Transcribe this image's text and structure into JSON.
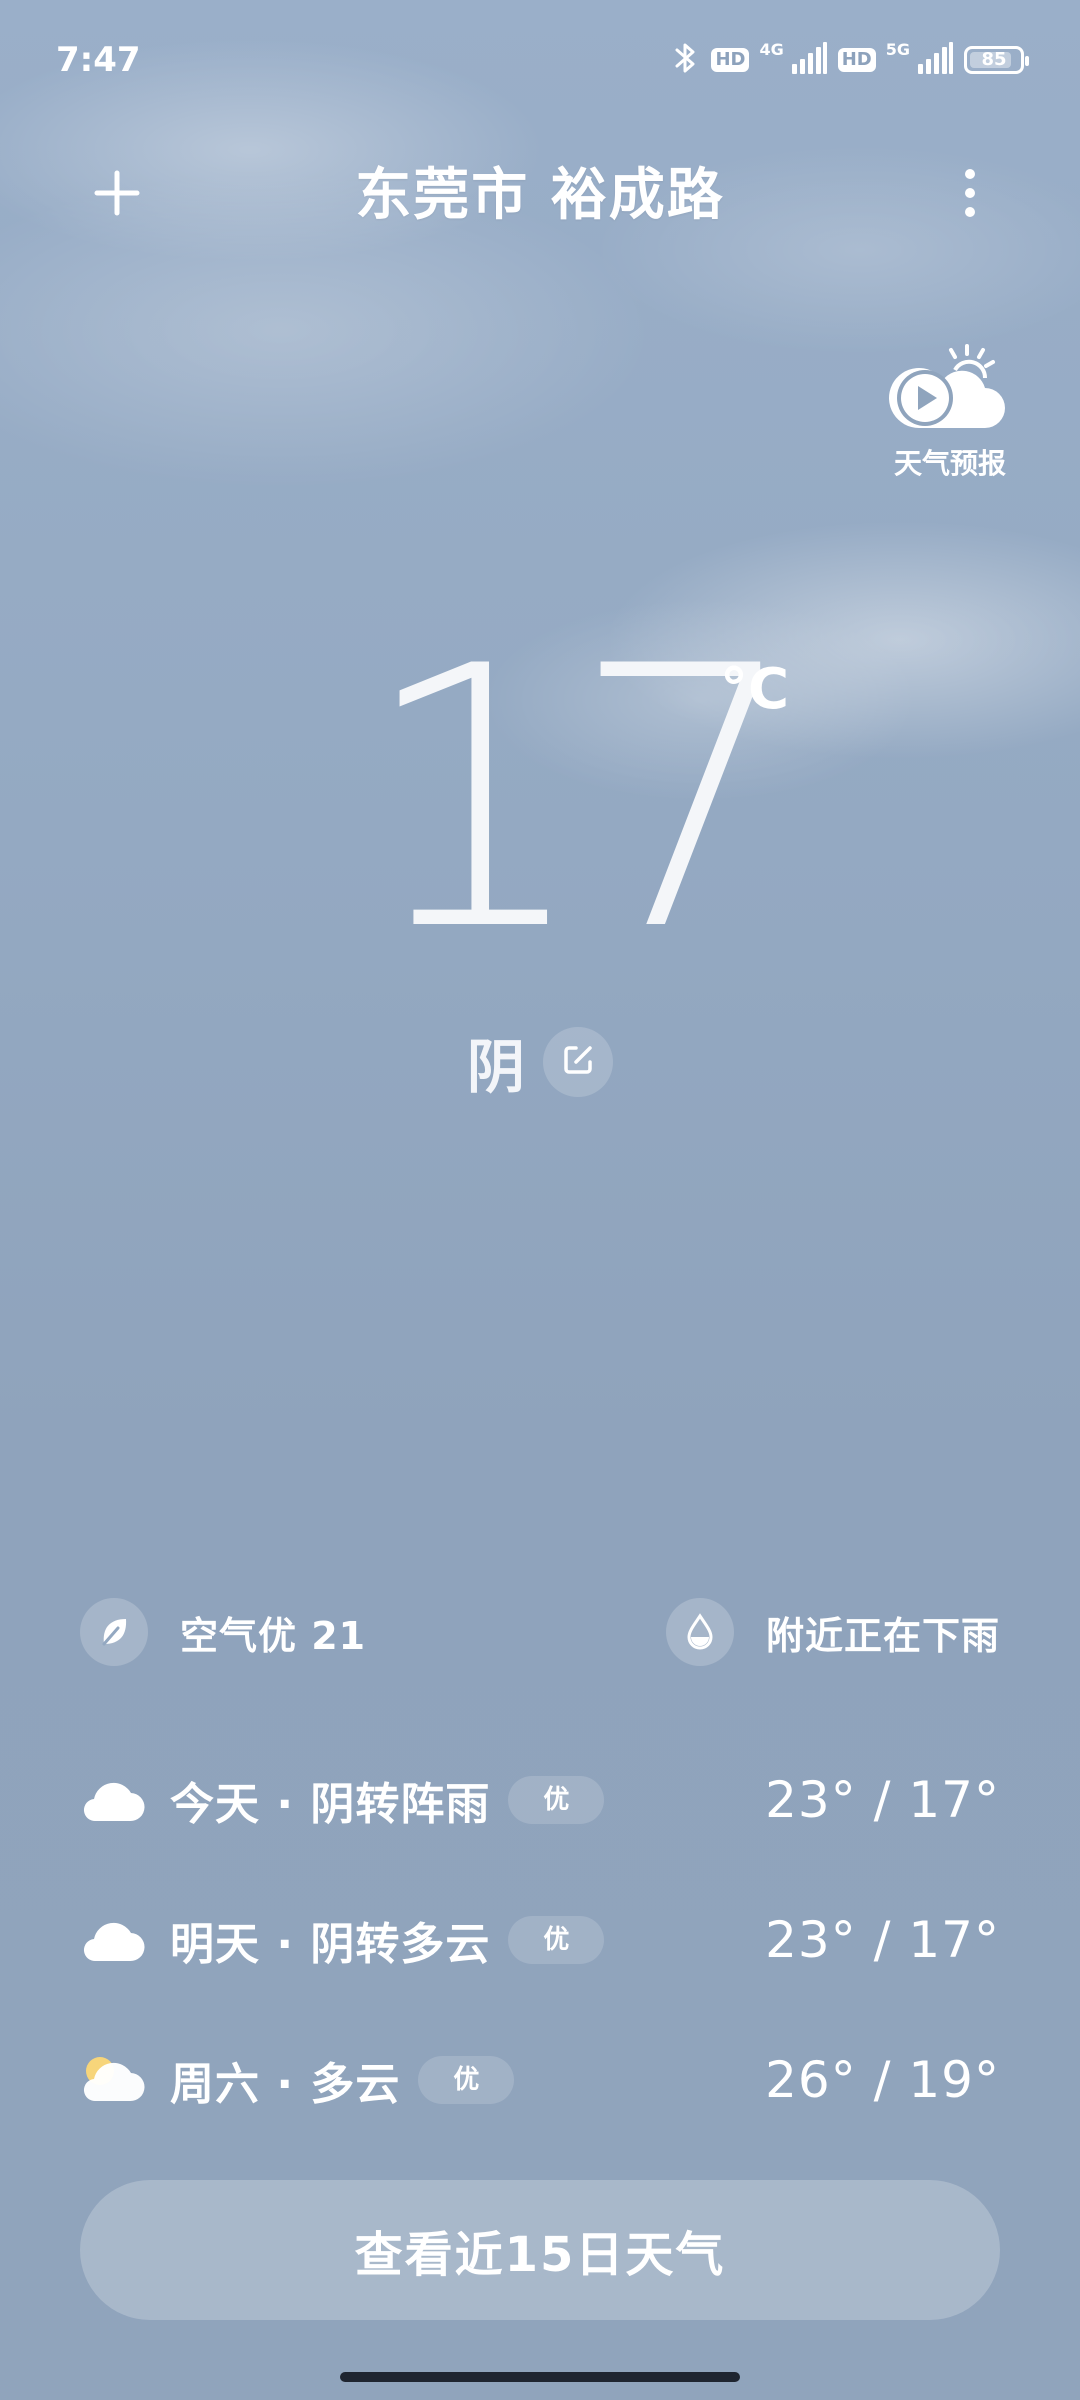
{
  "status_bar": {
    "time": "7:47",
    "hd_badge_1": "HD",
    "network_1": "4G",
    "hd_badge_2": "HD",
    "network_2": "5G",
    "battery": "85",
    "battery_level": 0.85
  },
  "header": {
    "add_icon": "plus-icon",
    "location": "东莞市 裕成路",
    "more_icon": "more-vertical-icon"
  },
  "forecast_video": {
    "icon": "play-cloud-icon",
    "label": "天气预报"
  },
  "current": {
    "temperature": "17",
    "unit": "°C",
    "condition": "阴",
    "edit_icon": "edit-icon"
  },
  "info": {
    "air_quality": "空气优 21",
    "air_icon": "leaf-icon",
    "rain": "附近正在下雨",
    "rain_icon": "water-drop-icon"
  },
  "daily": [
    {
      "icon": "cloudy-icon",
      "label": "今天 · 阴转阵雨",
      "aqi": "优",
      "range": "23° / 17°"
    },
    {
      "icon": "cloudy-icon",
      "label": "明天 · 阴转多云",
      "aqi": "优",
      "range": "23° / 17°"
    },
    {
      "icon": "partly-cloudy-icon",
      "label": "周六 · 多云",
      "aqi": "优",
      "range": "26° / 19°"
    }
  ],
  "fifteen_day_button": "查看近15日天气",
  "colors": {
    "background_top": "#9aafc9",
    "background_bottom": "#90a4bc",
    "text": "#ffffff",
    "sun": "#f7d57a"
  }
}
